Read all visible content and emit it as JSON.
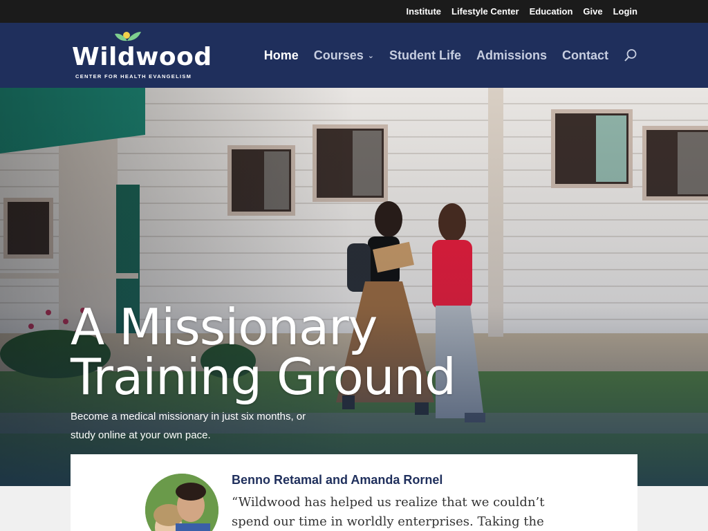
{
  "topbar": {
    "links": [
      "Institute",
      "Lifestyle Center",
      "Education",
      "Give",
      "Login"
    ]
  },
  "logo": {
    "word": "Wildwood",
    "tagline": "CENTER FOR HEALTH EVANGELISM"
  },
  "nav": {
    "items": [
      {
        "label": "Home",
        "active": true
      },
      {
        "label": "Courses",
        "active": false,
        "dropdown": true
      },
      {
        "label": "Student Life",
        "active": false
      },
      {
        "label": "Admissions",
        "active": false
      },
      {
        "label": "Contact",
        "active": false
      }
    ],
    "search_icon": "search-icon"
  },
  "hero": {
    "title_line1": "A Missionary",
    "title_line2": "Training Ground",
    "subtitle": "Become a medical missionary in just six months, or study online at your own pace."
  },
  "testimonial": {
    "name": "Benno Retamal and Amanda Rornel",
    "quote": "“Wildwood has helped us realize that we couldn’t spend our time in worldly enterprises. Taking the course also taught us"
  },
  "colors": {
    "topbar": "#1b1b1b",
    "header": "#1f2f5c",
    "accent_green": "#7ecf8e",
    "accent_yellow": "#f2d04a"
  }
}
